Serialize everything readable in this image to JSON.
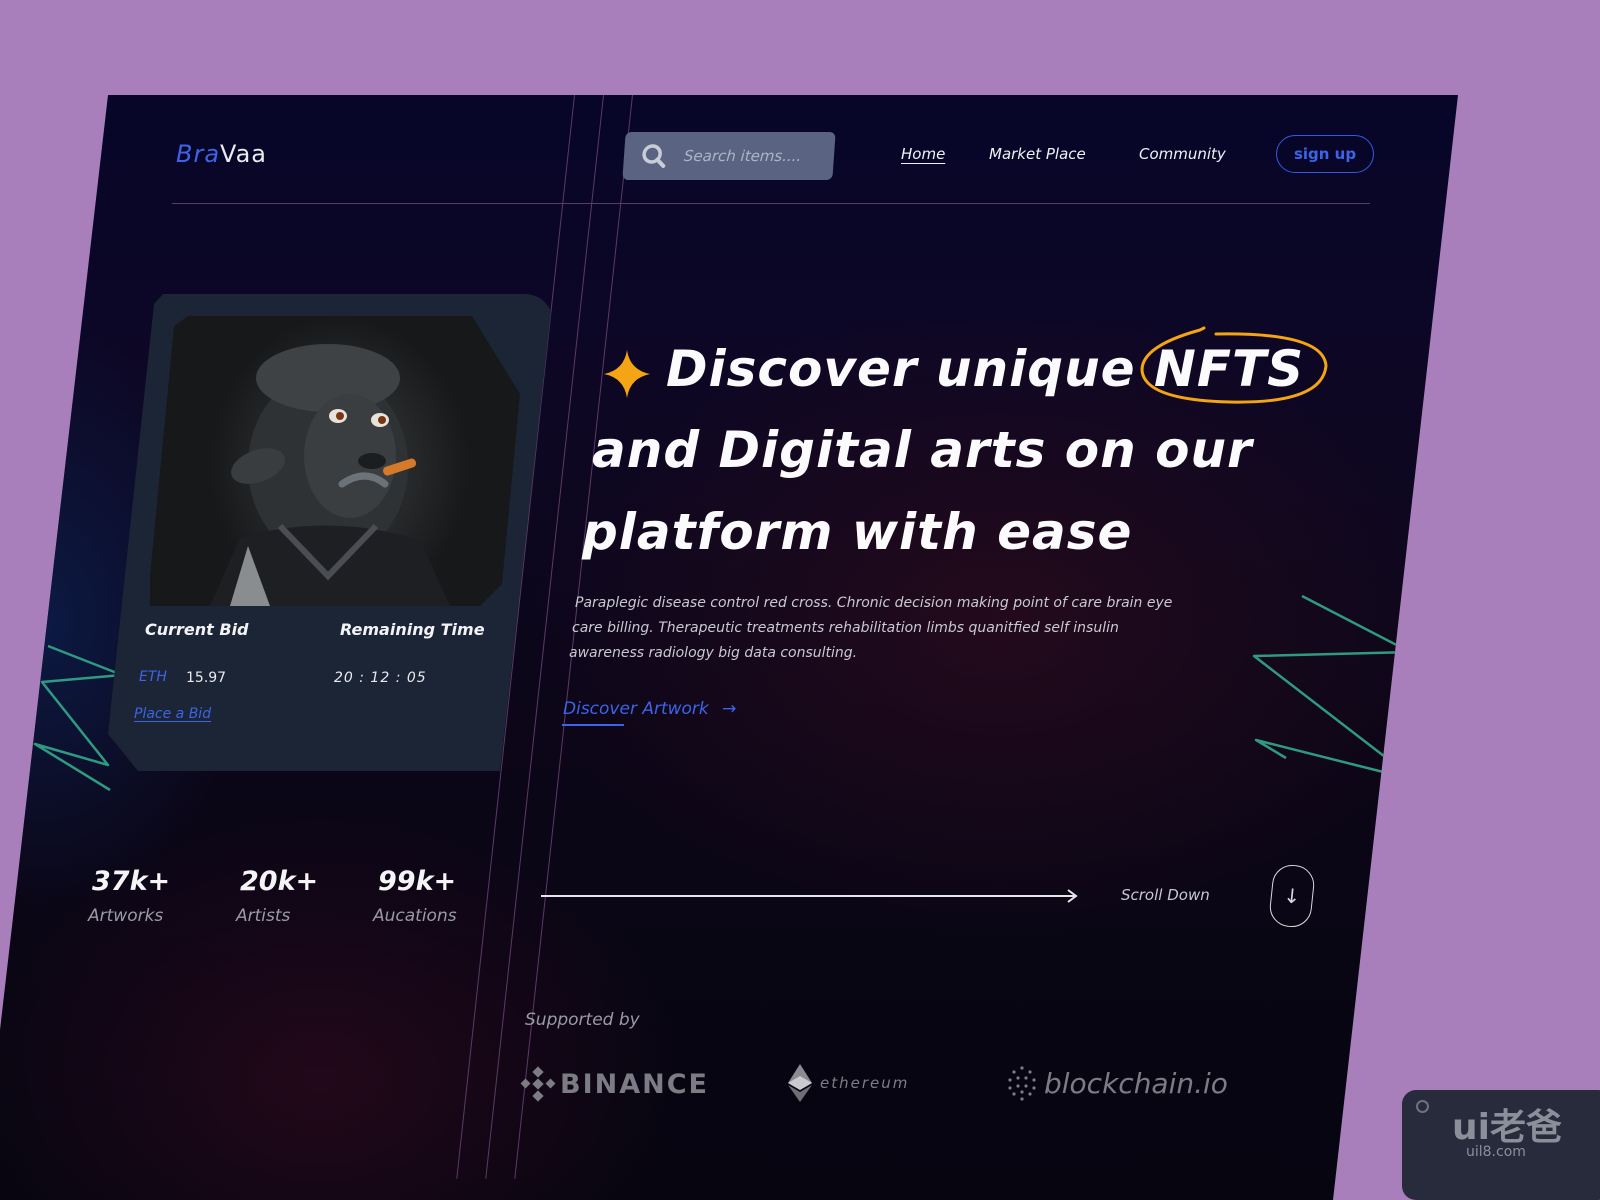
{
  "brand": {
    "part1": "Bra",
    "part2": "Vaa"
  },
  "search": {
    "placeholder": "Search items....",
    "value": ""
  },
  "nav": {
    "items": [
      {
        "label": "Home",
        "active": true
      },
      {
        "label": "Market Place",
        "active": false
      },
      {
        "label": "Community",
        "active": false
      }
    ],
    "signup_label": "sign up"
  },
  "nft_card": {
    "current_bid_label": "Current Bid",
    "remaining_time_label": "Remaining Time",
    "currency": "ETH",
    "bid_value": "15.97",
    "remaining_time": "20 : 12 : 05",
    "place_bid_label": "Place a Bid"
  },
  "hero": {
    "line1_prefix": "Discover unique",
    "line1_highlight": "NFTS",
    "line2": "and Digital arts on our",
    "line3": "platform with ease",
    "description_lines": [
      "Paraplegic disease control red cross. Chronic decision making point of care brain eye",
      "care billing. Therapeutic treatments rehabilitation limbs quanitfied self insulin",
      "awareness radiology big data consulting."
    ],
    "cta_label": "Discover Artwork"
  },
  "stats": [
    {
      "value": "37k+",
      "label": "Artworks"
    },
    {
      "value": "20k+",
      "label": "Artists"
    },
    {
      "value": "99k+",
      "label": "Aucations"
    }
  ],
  "scroll": {
    "label": "Scroll Down"
  },
  "supported": {
    "label": "Supported by",
    "partners": [
      "BINANCE",
      "ethereum",
      "blockchain.io"
    ]
  },
  "watermark": {
    "logo_text": "ui老爸",
    "site": "uil8.com"
  },
  "colors": {
    "accent_blue": "#3d63e8",
    "highlight_orange": "#f5a514",
    "squiggle_green": "#2e9a80",
    "background_outer": "#a97fbb"
  }
}
